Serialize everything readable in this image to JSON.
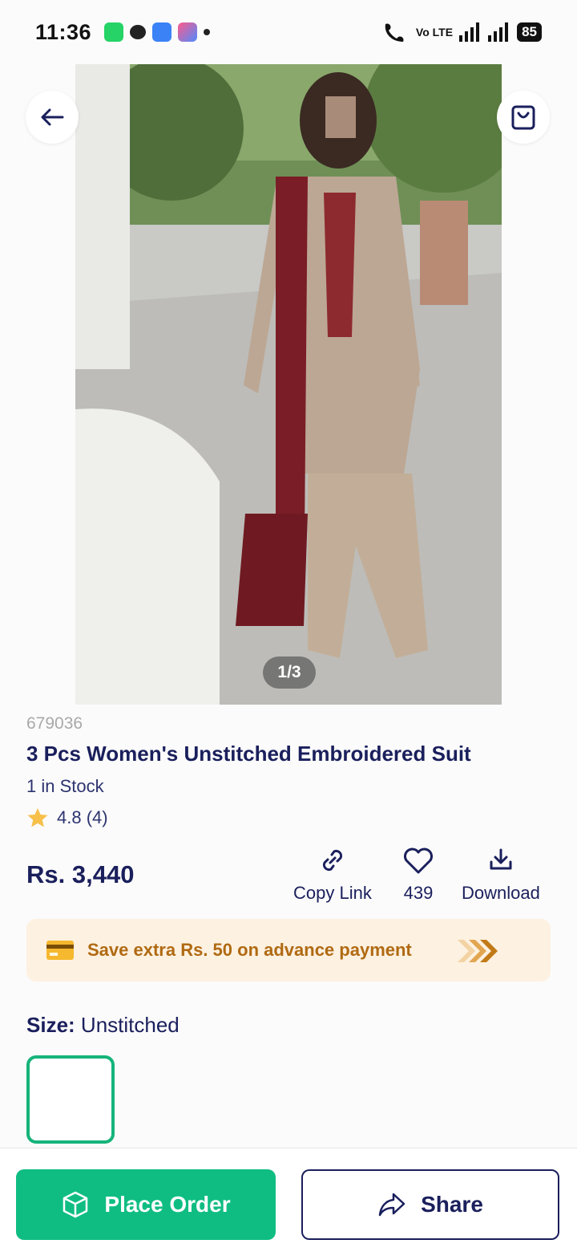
{
  "status_bar": {
    "time": "11:36",
    "network_label": "Vo LTE",
    "battery": "85"
  },
  "product": {
    "sku": "679036",
    "title": "3 Pcs Women's Unstitched Embroidered Suit",
    "stock": "1 in Stock",
    "rating": "4.8 (4)",
    "price": "Rs. 3,440",
    "image_pager": "1/3"
  },
  "actions": {
    "copy_link": "Copy Link",
    "likes": "439",
    "download": "Download"
  },
  "promo": {
    "text": "Save extra Rs. 50 on advance payment"
  },
  "size": {
    "label": "Size:",
    "value": "Unstitched"
  },
  "bottom": {
    "place_order": "Place Order",
    "share": "Share"
  },
  "colors": {
    "primary": "#0fbd82",
    "navy": "#1a1f5c",
    "promo_bg": "#fdf1e1",
    "promo_text": "#b06a12"
  }
}
